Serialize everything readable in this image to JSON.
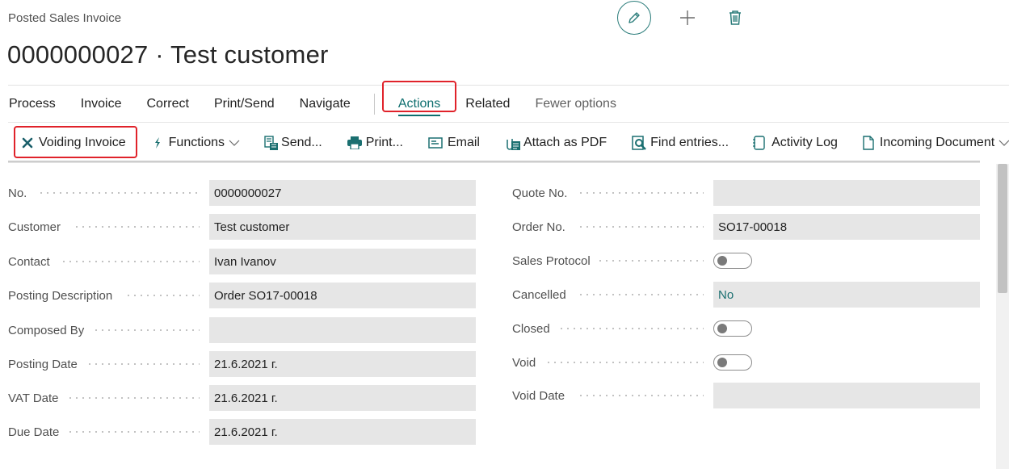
{
  "page": {
    "caption": "Posted Sales Invoice",
    "title": "0000000027 · Test customer"
  },
  "top_icons": [
    "edit-icon",
    "plus-icon",
    "trash-icon"
  ],
  "tabs": [
    {
      "label": "Process"
    },
    {
      "label": "Invoice"
    },
    {
      "label": "Correct"
    },
    {
      "label": "Print/Send"
    },
    {
      "label": "Navigate"
    },
    {
      "label": "Actions"
    },
    {
      "label": "Related"
    },
    {
      "label": "Fewer options"
    }
  ],
  "actions": [
    {
      "label": "Voiding Invoice",
      "icon": "close-icon"
    },
    {
      "label": "Functions",
      "icon": "lightning-icon"
    },
    {
      "label": "Send...",
      "icon": "send-icon"
    },
    {
      "label": "Print...",
      "icon": "printer-icon"
    },
    {
      "label": "Email",
      "icon": "email-icon"
    },
    {
      "label": "Attach as PDF",
      "icon": "attach-pdf-icon"
    },
    {
      "label": "Find entries...",
      "icon": "find-entries-icon"
    },
    {
      "label": "Activity Log",
      "icon": "activity-log-icon"
    },
    {
      "label": "Incoming Document",
      "icon": "document-icon"
    }
  ],
  "left_fields": [
    {
      "label": "No.",
      "value": "0000000027"
    },
    {
      "label": "Customer",
      "value": "Test customer"
    },
    {
      "label": "Contact",
      "value": "Ivan Ivanov"
    },
    {
      "label": "Posting Description",
      "value": "Order SO17-00018"
    },
    {
      "label": "Composed By",
      "value": ""
    },
    {
      "label": "Posting Date",
      "value": "21.6.2021 г."
    },
    {
      "label": "VAT Date",
      "value": "21.6.2021 г."
    },
    {
      "label": "Due Date",
      "value": "21.6.2021 г."
    }
  ],
  "right_fields": [
    {
      "label": "Quote No.",
      "value": ""
    },
    {
      "label": "Order No.",
      "value": "SO17-00018"
    },
    {
      "label": "Sales Protocol",
      "toggle": false
    },
    {
      "label": "Cancelled",
      "value": "No"
    },
    {
      "label": "Closed",
      "toggle": false
    },
    {
      "label": "Void",
      "toggle": false
    },
    {
      "label": "Void Date",
      "value": ""
    }
  ],
  "colors": {
    "accent": "#0d6e6e",
    "highlight_box": "#e0222a",
    "field_bg": "#e6e6e6"
  }
}
